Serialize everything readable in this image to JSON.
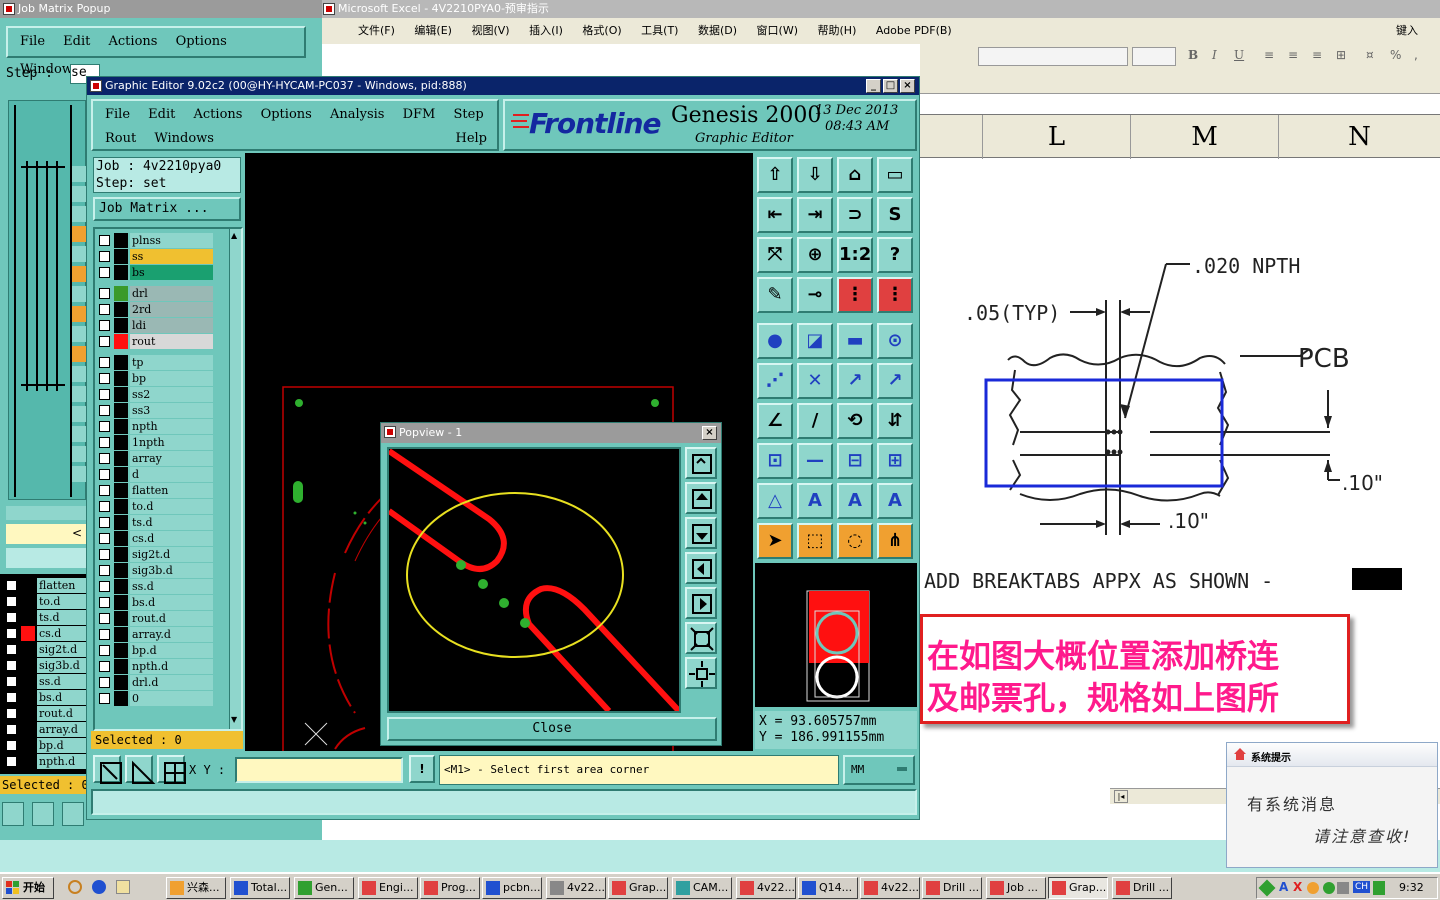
{
  "excel": {
    "title": "Microsoft Excel - 4V2210PYA0-预审指示",
    "menu": [
      "文件(F)",
      "编辑(E)",
      "视图(V)",
      "插入(I)",
      "格式(O)",
      "工具(T)",
      "数据(D)",
      "窗口(W)",
      "帮助(H)",
      "Adobe PDF(B)"
    ],
    "help_hint": "键入",
    "columns": [
      "L",
      "M",
      "N"
    ],
    "drawing": {
      "npth_label": ".020 NPTH",
      "typ_label": ".05(TYP)",
      "pcb_label": "PCB",
      "dim_right": ".10\"",
      "dim_bottom": ".10\"",
      "note": "ADD BREAKTABS APPX AS SHOWN -"
    },
    "instruction_line1": "在如图大概位置添加桥连",
    "instruction_line2": "及邮票孔，规格如上图所"
  },
  "jobmatrix": {
    "title": "Job Matrix Popup",
    "menu": [
      "File",
      "Edit",
      "Actions",
      "Options",
      "Windows"
    ],
    "step_label": "Step :",
    "step_value": "se",
    "lower_layers": [
      "flatten",
      "to.d",
      "ts.d",
      "cs.d",
      "sig2t.d",
      "sig3b.d",
      "ss.d",
      "bs.d",
      "rout.d",
      "array.d",
      "bp.d",
      "npth.d"
    ],
    "selected_label": "Selected : 0"
  },
  "editor": {
    "title": "Graphic Editor 9.02c2 (00@HY-HYCAM-PC037 - Windows, pid:888)",
    "menu_row1": [
      "File",
      "Edit",
      "Actions",
      "Options",
      "Analysis",
      "DFM",
      "Step"
    ],
    "menu_row2": [
      "Rout",
      "Windows"
    ],
    "help": "Help",
    "brand": "Frontline",
    "product": "Genesis 2000",
    "subtitle": "Graphic Editor",
    "date": "13 Dec 2013",
    "time": "08:43 AM",
    "job_label": "Job : 4v2210pya0",
    "step_label": "Step: set",
    "job_matrix_button": "Job Matrix ...",
    "layers": [
      {
        "name": "plnss",
        "swatch": "#000000",
        "bg": "#8fd6cc"
      },
      {
        "name": "ss",
        "swatch": "#000000",
        "bg": "#f0c030"
      },
      {
        "name": "bs",
        "swatch": "#000000",
        "bg": "#1aa070"
      },
      {
        "name": "drl",
        "swatch": "#3a9a2a",
        "bg": "#9ab8b4"
      },
      {
        "name": "2rd",
        "swatch": "#000000",
        "bg": "#9ab8b4"
      },
      {
        "name": "ldi",
        "swatch": "#000000",
        "bg": "#9ab8b4"
      },
      {
        "name": "rout",
        "swatch": "#ff1010",
        "bg": "#d8d8d8"
      },
      {
        "name": "tp",
        "swatch": "#000000",
        "bg": "#8fd6cc"
      },
      {
        "name": "bp",
        "swatch": "#000000",
        "bg": "#8fd6cc"
      },
      {
        "name": "ss2",
        "swatch": "#000000",
        "bg": "#8fd6cc"
      },
      {
        "name": "ss3",
        "swatch": "#000000",
        "bg": "#8fd6cc"
      },
      {
        "name": "npth",
        "swatch": "#000000",
        "bg": "#8fd6cc"
      },
      {
        "name": "1npth",
        "swatch": "#000000",
        "bg": "#8fd6cc"
      },
      {
        "name": "array",
        "swatch": "#000000",
        "bg": "#8fd6cc"
      },
      {
        "name": "d",
        "swatch": "#000000",
        "bg": "#8fd6cc"
      },
      {
        "name": "flatten",
        "swatch": "#000000",
        "bg": "#8fd6cc"
      },
      {
        "name": "to.d",
        "swatch": "#000000",
        "bg": "#8fd6cc"
      },
      {
        "name": "ts.d",
        "swatch": "#000000",
        "bg": "#8fd6cc"
      },
      {
        "name": "cs.d",
        "swatch": "#000000",
        "bg": "#8fd6cc"
      },
      {
        "name": "sig2t.d",
        "swatch": "#000000",
        "bg": "#8fd6cc"
      },
      {
        "name": "sig3b.d",
        "swatch": "#000000",
        "bg": "#8fd6cc"
      },
      {
        "name": "ss.d",
        "swatch": "#000000",
        "bg": "#8fd6cc"
      },
      {
        "name": "bs.d",
        "swatch": "#000000",
        "bg": "#8fd6cc"
      },
      {
        "name": "rout.d",
        "swatch": "#000000",
        "bg": "#8fd6cc"
      },
      {
        "name": "array.d",
        "swatch": "#000000",
        "bg": "#8fd6cc"
      },
      {
        "name": "bp.d",
        "swatch": "#000000",
        "bg": "#8fd6cc"
      },
      {
        "name": "npth.d",
        "swatch": "#000000",
        "bg": "#8fd6cc"
      },
      {
        "name": "drl.d",
        "swatch": "#000000",
        "bg": "#8fd6cc"
      },
      {
        "name": "0",
        "swatch": "#000000",
        "bg": "#8fd6cc"
      }
    ],
    "selected_label": "Selected : 0",
    "xy_label": "X Y :",
    "xy_value": "",
    "prompt": "<M1> - Select first area corner",
    "units": "MM",
    "coord_x": "X = 93.605757mm",
    "coord_y": "Y = 186.991155mm"
  },
  "popview": {
    "title": "Popview - 1",
    "close_label": "Close"
  },
  "taskbar": {
    "start": "开始",
    "tasks": [
      "兴森...",
      "Total...",
      "Gen...",
      "Engi...",
      "Prog...",
      "pcbn...",
      "4v22...",
      "Grap...",
      "CAM...",
      "4v22...",
      "Q14...",
      "4v22...",
      "Drill ...",
      "Job ...",
      "Grap...",
      "Drill ..."
    ],
    "clock": "9:32",
    "lang": "CH"
  },
  "notify": {
    "title": "系统提示",
    "line1": "有系统消息",
    "line2": "请注意查收!"
  }
}
